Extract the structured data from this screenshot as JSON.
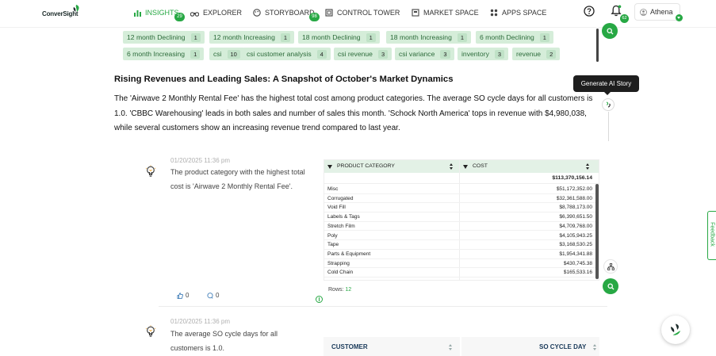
{
  "brand": {
    "logo_text": "ConverSight",
    "accent_color": "#27a844"
  },
  "nav": {
    "items": [
      {
        "label": "INSIGHTS",
        "icon": "bar-chart-icon",
        "badge": "29",
        "active": true
      },
      {
        "label": "EXPLORER",
        "icon": "binoculars-icon"
      },
      {
        "label": "STORYBOARD",
        "icon": "palette-icon",
        "badge": "98"
      },
      {
        "label": "CONTROL TOWER",
        "icon": "tower-icon"
      },
      {
        "label": "MARKET SPACE",
        "icon": "store-icon"
      },
      {
        "label": "APPS SPACE",
        "icon": "apps-grid-icon"
      }
    ],
    "notifications_badge": "62",
    "user_name": "Athena"
  },
  "tags": [
    {
      "label": "12 month Declining",
      "count": "1"
    },
    {
      "label": "12 month Increasing",
      "count": "1"
    },
    {
      "label": "18 month Declining",
      "count": "1"
    },
    {
      "label": "18 month Increasing",
      "count": "1"
    },
    {
      "label": "6 month Declining",
      "count": "1"
    },
    {
      "label": "6 month Increasing",
      "count": "1"
    },
    {
      "label": "csi",
      "count": "10"
    },
    {
      "label": "csi customer analysis",
      "count": "4"
    },
    {
      "label": "csi revenue",
      "count": "3"
    },
    {
      "label": "csi variance",
      "count": "3"
    },
    {
      "label": "inventory",
      "count": "3"
    },
    {
      "label": "revenue",
      "count": "2"
    }
  ],
  "story": {
    "title": "Rising Revenues and Leading Sales: A Snapshot of October's Market Dynamics",
    "body": "The 'Airwave 2 Monthly Rental Fee' has the highest total cost among product categories. The average SO cycle days for all customers is 1.0. 'CBBC Warehousing' leads in both sales and number of sales this month. 'Schock North America' tops in revenue with $4,980,038, while several customers show an increasing revenue trend compared to last year.",
    "tooltip": "Generate AI Story"
  },
  "insight1": {
    "timestamp": "01/20/2025 11:36 pm",
    "text": "The product category with the highest total cost is 'Airwave 2 Monthly Rental Fee'.",
    "likes": "0",
    "comments": "0",
    "table": {
      "col1": "PRODUCT CATEGORY",
      "col2": "COST",
      "total": "$113,370,156.14",
      "rows": [
        {
          "category": "Misc",
          "cost": "$51,172,352.00"
        },
        {
          "category": "Corrugated",
          "cost": "$32,361,588.00"
        },
        {
          "category": "Void Fill",
          "cost": "$8,788,173.00"
        },
        {
          "category": "Labels & Tags",
          "cost": "$6,390,651.50"
        },
        {
          "category": "Stretch Film",
          "cost": "$4,709,768.00"
        },
        {
          "category": "Poly",
          "cost": "$4,105,943.25"
        },
        {
          "category": "Tape",
          "cost": "$3,168,530.25"
        },
        {
          "category": "Parts & Equipment",
          "cost": "$1,954,341.88"
        },
        {
          "category": "Strapping",
          "cost": "$430,745.38"
        },
        {
          "category": "Cold Chain",
          "cost": "$165,533.16"
        }
      ],
      "rows_label": "Rows:",
      "rows_count": "12"
    }
  },
  "insight2": {
    "timestamp": "01/20/2025 11:36 pm",
    "text": "The average SO cycle days for all customers is 1.0.",
    "table": {
      "col1": "CUSTOMER",
      "col2": "SO CYCLE DAY"
    }
  },
  "feedback_label": "Feedback"
}
